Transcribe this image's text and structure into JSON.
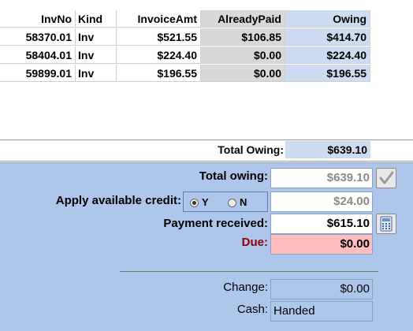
{
  "grid": {
    "columns": [
      "InvNo",
      "Kind",
      "InvoiceAmt",
      "AlreadyPaid",
      "Owing"
    ],
    "rows": [
      {
        "invno": "58370.01",
        "kind": "Inv",
        "invoiceamt": "$521.55",
        "alreadypaid": "$106.85",
        "owing": "$414.70"
      },
      {
        "invno": "58404.01",
        "kind": "Inv",
        "invoiceamt": "$224.40",
        "alreadypaid": "$0.00",
        "owing": "$224.40"
      },
      {
        "invno": "59899.01",
        "kind": "Inv",
        "invoiceamt": "$196.55",
        "alreadypaid": "$0.00",
        "owing": "$196.55"
      }
    ],
    "total_label": "Total Owing:",
    "total_value": "$639.10"
  },
  "payment": {
    "total_owing_label": "Total owing:",
    "total_owing_value": "$639.10",
    "apply_credit_label": "Apply available credit:",
    "credit_option_yes": "Y",
    "credit_option_no": "N",
    "credit_selected": "Y",
    "credit_value": "$24.00",
    "payment_received_label": "Payment received:",
    "payment_received_value": "$615.10",
    "due_label": "Due:",
    "due_value": "$0.00",
    "change_label": "Change:",
    "change_value": "$0.00",
    "cash_label": "Cash:",
    "cash_value": "Handed"
  },
  "icons": {
    "total_owing_button": "checkmark-icon",
    "payment_button": "calculator-icon"
  },
  "colors": {
    "panel_bg": "#aec6ea",
    "due_bg": "#ffbdbd",
    "due_label": "#8b0000",
    "owing_col_bg": "#cddcf0",
    "paid_col_bg": "#d8d8d8"
  }
}
